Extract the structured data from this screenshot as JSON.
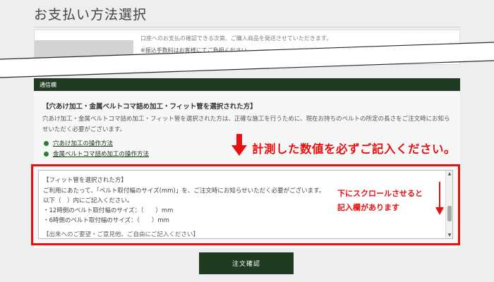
{
  "header": {
    "title": "お支払い方法選択"
  },
  "payment": {
    "note_line1": "口座へのお支払の確認できる次第、ご購入商品を発送させていただきます。",
    "note_line2": "※振込手数料はお客様にてご負担ください。"
  },
  "notes_section": {
    "bar_label": "通信欄",
    "heading": "【穴あけ加工・金属ベルトコマ詰め加工・フィット管を選択された方】",
    "description": "穴あけ加工・金属ベルトコマ詰め加工・フィット管を選択された方は、正確な施工を行うために、現在お持ちのベルトの所定の長さをご注文時にお知らせいただく必要がございます。",
    "links": [
      "穴あけ加工の操作方法",
      "金属ベルトコマ詰め加工の操作方法"
    ]
  },
  "annotations": {
    "main": "計測した数値を必ずご記入ください。",
    "scroll_line1": "下にスクロールさせると",
    "scroll_line2": "記入欄があります",
    "color": "#e8100f"
  },
  "textarea": {
    "lines": [
      "【フィット管を選択された方】",
      "ご利用にあたって、「ベルト取付幅のサイズ(mm)」を、ご注文時にお知らせいただく必要がございます。",
      "以下（　）内にご記入ください。",
      "・12時側のベルト取付幅のサイズ：（　　）mm",
      "・6時側のベルト取付幅のサイズ：（　　）mm",
      "【出来へのご要望・ご意見他、ご自由にご記入ください】"
    ]
  },
  "actions": {
    "confirm_label": "注文確認"
  },
  "colors": {
    "brand_green": "#1f3b22",
    "link_dot": "#2e7d32"
  }
}
